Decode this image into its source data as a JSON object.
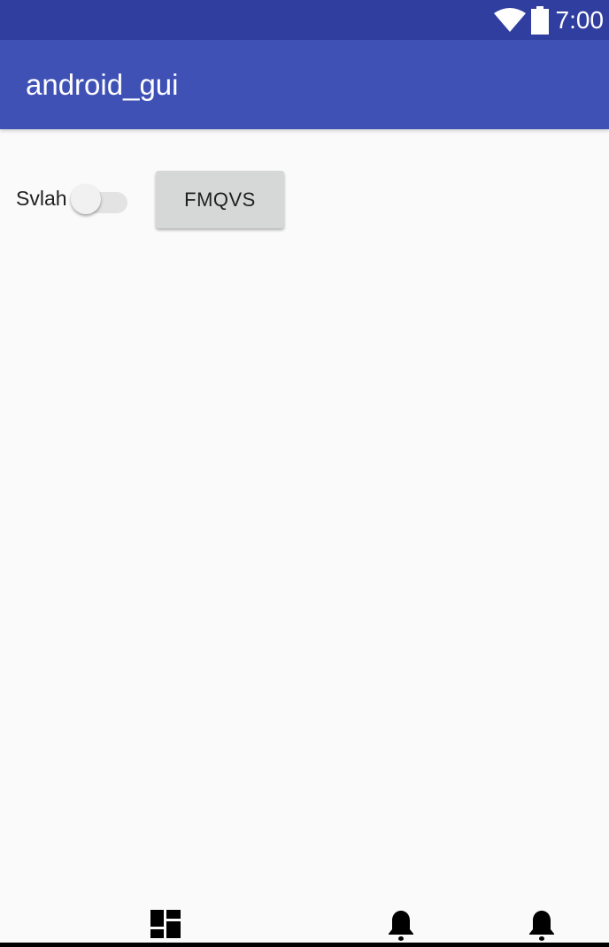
{
  "status_bar": {
    "time": "7:00",
    "icons": [
      "wifi-icon",
      "battery-icon"
    ],
    "color": "#303f9f"
  },
  "app_bar": {
    "title": "android_gui",
    "color": "#3f51b5"
  },
  "content": {
    "switch": {
      "label": "Svlah",
      "checked": false
    },
    "button": {
      "label": "FMQVS"
    }
  },
  "bottom_nav": {
    "items": [
      {
        "icon": "dashboard-icon"
      },
      {
        "icon": "bell-icon"
      },
      {
        "icon": "bell-icon"
      }
    ]
  }
}
